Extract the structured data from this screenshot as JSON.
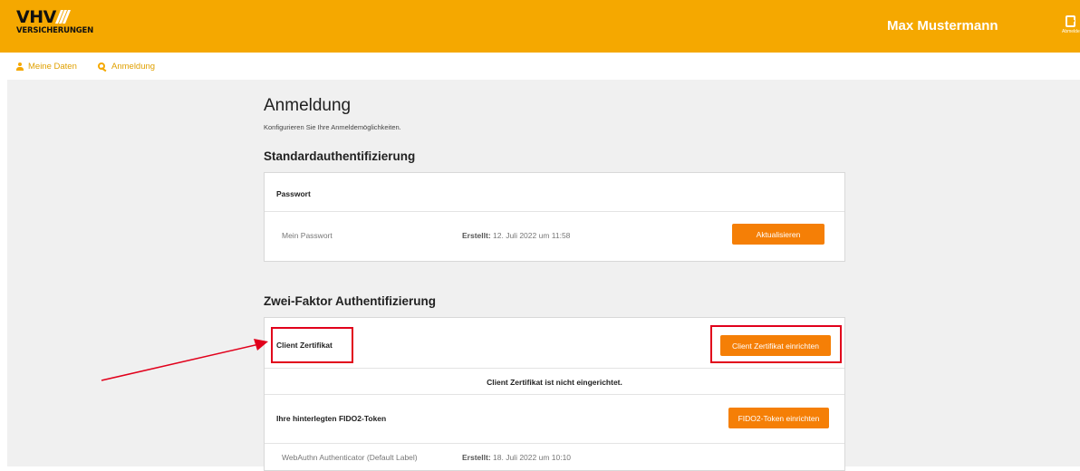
{
  "header": {
    "logo_text": "VHV",
    "logo_subtext": "VERSICHERUNGEN",
    "user_name": "Max Mustermann",
    "logout_label": "Abmelden"
  },
  "subnav": {
    "items": [
      {
        "label": "Meine Daten",
        "icon": "person-icon"
      },
      {
        "label": "Anmeldung",
        "icon": "key-icon"
      }
    ]
  },
  "page": {
    "title": "Anmeldung",
    "subtitle": "Konfigurieren Sie Ihre Anmeldemöglichkeiten."
  },
  "standard_auth": {
    "section_title": "Standardauthentifizierung",
    "card_title": "Passwort",
    "item_label": "Mein Passwort",
    "created_label": "Erstellt:",
    "created_value": "12. Juli 2022 um 11:58",
    "button_label": "Aktualisieren"
  },
  "two_factor": {
    "section_title": "Zwei-Faktor Authentifizierung",
    "client_cert_title": "Client Zertifikat",
    "client_cert_button": "Client Zertifikat einrichten",
    "client_cert_status": "Client Zertifikat ist nicht eingerichtet.",
    "fido_title": "Ihre hinterlegten FIDO2-Token",
    "fido_button": "FIDO2-Token einrichten",
    "token_label": "WebAuthn Authenticator (Default Label)",
    "token_created_label": "Erstellt:",
    "token_created_value": "18. Juli 2022 um 10:10"
  },
  "colors": {
    "brand": "#f5a800",
    "button": "#f57f06",
    "highlight": "#e1001b"
  }
}
